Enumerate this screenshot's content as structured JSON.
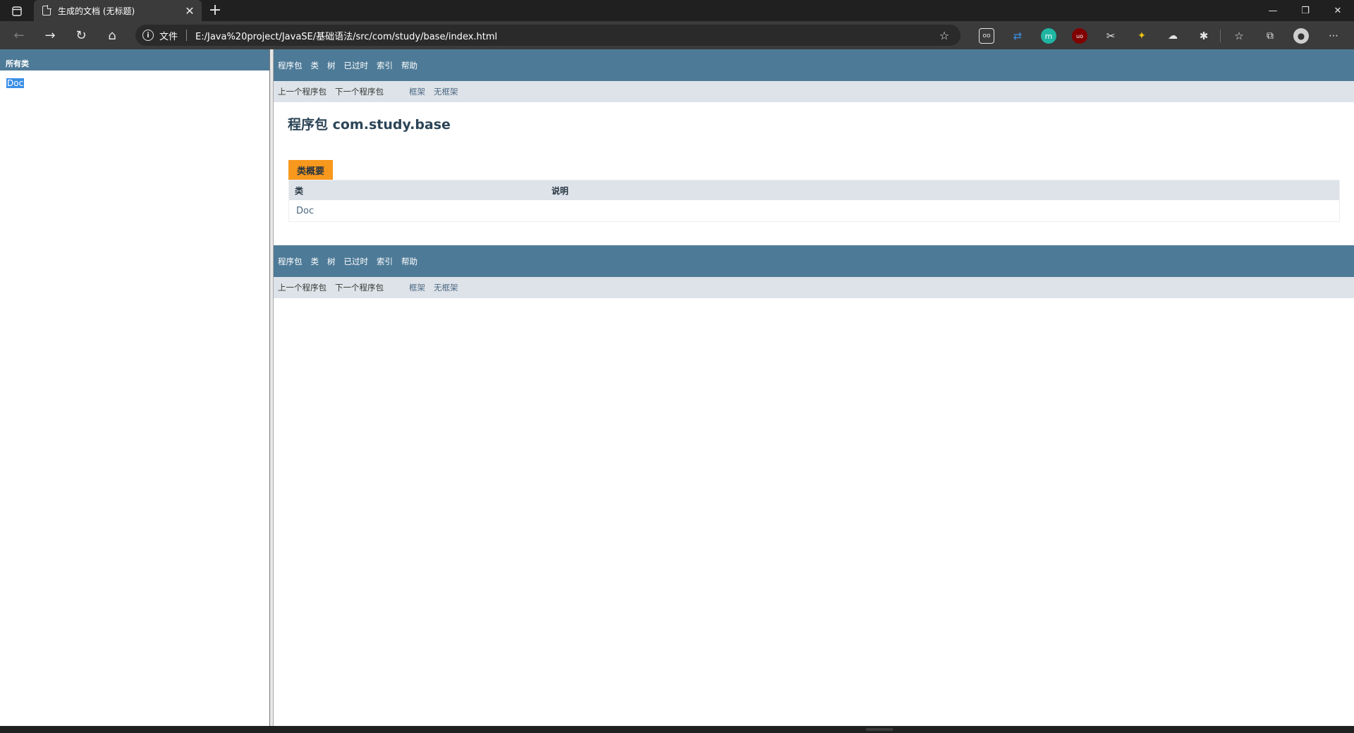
{
  "browser": {
    "tab_title": "生成的文档 (无标题)",
    "address_label": "文件",
    "url": "E:/Java%20project/JavaSE/基础语法/src/com/study/base/index.html",
    "icons": {
      "tab_actions": "tab-actions-icon",
      "page": "page-icon",
      "close": "close-icon",
      "new_tab": "plus-icon",
      "back": "back-arrow-icon",
      "forward": "forward-arrow-icon",
      "refresh": "refresh-icon",
      "home": "home-icon",
      "info": "info-icon",
      "favorite_add": "star-add-icon",
      "favorites": "favorites-icon",
      "collections": "collections-icon",
      "profile": "profile-avatar-icon",
      "menu": "more-icon",
      "minimize": "minimize-icon",
      "restore": "restore-icon",
      "window_close": "window-close-icon"
    }
  },
  "left_frame": {
    "header": "所有类",
    "classes": [
      "Doc"
    ]
  },
  "right_frame": {
    "top_nav": [
      "程序包",
      "类",
      "树",
      "已过时",
      "索引",
      "帮助"
    ],
    "sub_nav": {
      "prev_package": "上一个程序包",
      "next_package": "下一个程序包",
      "frames": "框架",
      "no_frames": "无框架"
    },
    "package_title": "程序包 com.study.base",
    "summary_caption": "类概要",
    "table": {
      "headers": [
        "类",
        "说明"
      ],
      "rows": [
        {
          "class": "Doc",
          "description": ""
        }
      ]
    }
  },
  "colors": {
    "nav_bg": "#4d7a97",
    "subnav_bg": "#dee3e9",
    "caption_bg": "#f8981d",
    "link": "#4a6782",
    "title": "#2c4557"
  }
}
